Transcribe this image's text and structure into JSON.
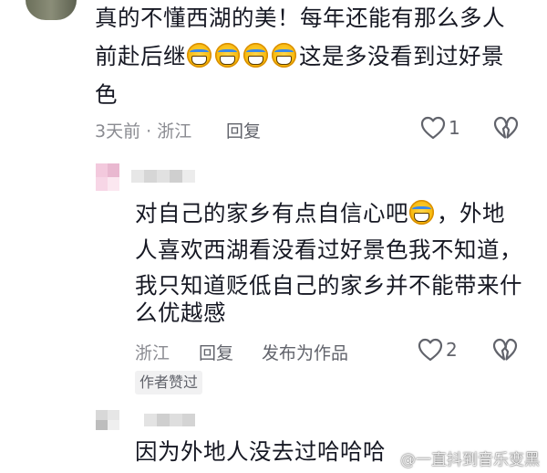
{
  "comments": [
    {
      "lines": [
        "真的不懂西湖的美！每年还能有那么多人",
        "前赴后继",
        "这是多没看到过好景",
        "色"
      ],
      "emoji_count": 4,
      "time_location": "3天前 · 浙江",
      "reply_label": "回复",
      "likes": "1"
    },
    {
      "lines": [
        "对自己的家乡有点自信心吧",
        "，外地",
        "人喜欢西湖看没看过好景色我不知道，",
        "我只知道贬低自己的家乡并不能带来什",
        "么优越感"
      ],
      "location": "浙江",
      "reply_label": "回复",
      "publish_label": "发布为作品",
      "likes": "2",
      "author_badge": "作者赞过"
    },
    {
      "lines": [
        "因为外地人没去过哈哈哈"
      ]
    }
  ],
  "watermark": "@一直抖到音乐变黑",
  "icons": {
    "like": "heart-outline-icon",
    "dislike": "broken-heart-icon",
    "emoji": "laughing-tears-emoji"
  }
}
